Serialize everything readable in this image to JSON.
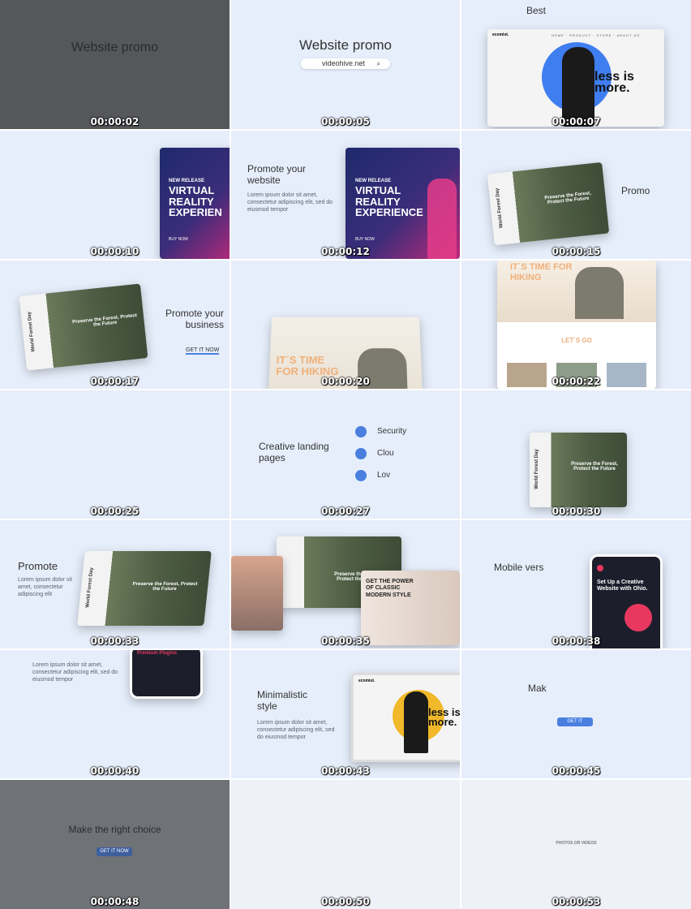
{
  "frames": [
    {
      "time": "00:00:02",
      "title": "Website promo"
    },
    {
      "time": "00:00:05",
      "title": "Website promo",
      "url": "videohive.net"
    },
    {
      "time": "00:00:07",
      "top_text": "Best",
      "logo": "ecomist.",
      "nav": [
        "HOME",
        "PRODUCT",
        "STORE",
        "ABOUT US"
      ],
      "headline": "less is more."
    },
    {
      "time": "00:00:10",
      "banner": {
        "kicker": "NEW RELEASE",
        "headline": "VIRTUAL REALITY EXPERIEN",
        "cta": "BUY NOW"
      }
    },
    {
      "time": "00:00:12",
      "title": "Promote your website",
      "body": "Lorem ipsum dolor sit amet, consectetur adipiscing elit, sed do eiusmod tempor",
      "banner": {
        "kicker": "NEW RELEASE",
        "headline": "VIRTUAL REALITY EXPERIENCE",
        "cta": "BUY NOW"
      }
    },
    {
      "time": "00:00:15",
      "side_text": "Promo",
      "card_title": "World Forest Day",
      "card_headline": "Preserve the Forest, Protect the Future"
    },
    {
      "time": "00:00:17",
      "title": "Promote your business",
      "cta": "GET IT NOW",
      "card_title": "World Forest Day",
      "card_headline": "Preserve the Forest, Protect the Future"
    },
    {
      "time": "00:00:20",
      "headline": "IT´S TIME FOR HIKING"
    },
    {
      "time": "00:00:22",
      "headline": "IT´S TIME FOR HIKING",
      "sub": "LET´S GO"
    },
    {
      "time": "00:00:25"
    },
    {
      "time": "00:00:27",
      "title": "Creative landing pages",
      "features": [
        "Security",
        "Clou",
        "Lov"
      ]
    },
    {
      "time": "00:00:30",
      "card_title": "World Forest Day",
      "card_headline": "Preserve the Forest, Protect the Future"
    },
    {
      "time": "00:00:33",
      "title": "Promote",
      "body": "Lorem ipsum dolor sit amet, consectetur adipiscing elit",
      "card_title": "World Forest Day",
      "card_headline": "Preserve the Forest, Protect the Future"
    },
    {
      "time": "00:00:35",
      "card_headline": "Preserve the Forest, Protect the Future",
      "style_headline": "GET THE POWER OF CLASSIC MODERN STYLE"
    },
    {
      "time": "00:00:38",
      "title": "Mobile vers",
      "phone_headline": "Set Up a Creative Website with Ohio."
    },
    {
      "time": "00:00:40",
      "body": "Lorem ipsum dolor sit amet, consectetur adipiscing elit, sed do eiusmod tempor",
      "phone_headline": "Premium Plugins"
    },
    {
      "time": "00:00:43",
      "title": "Minimalistic style",
      "body": "Lorem ipsum dolor sit amet, consectetur adipiscing elit, sed do eiusmod tempor",
      "headline": "less is more.",
      "logo": "ecomist."
    },
    {
      "time": "00:00:45",
      "title": "Mak",
      "cta": "GET IT"
    },
    {
      "time": "00:00:48",
      "title": "Make the right choice",
      "cta": "GET IT NOW"
    },
    {
      "time": "00:00:50"
    },
    {
      "time": "00:00:53",
      "credit": "PHOTOS OR VIDEOS"
    }
  ],
  "colors": {
    "accent": "#4a7fe0",
    "bg": "#e6eefb"
  }
}
